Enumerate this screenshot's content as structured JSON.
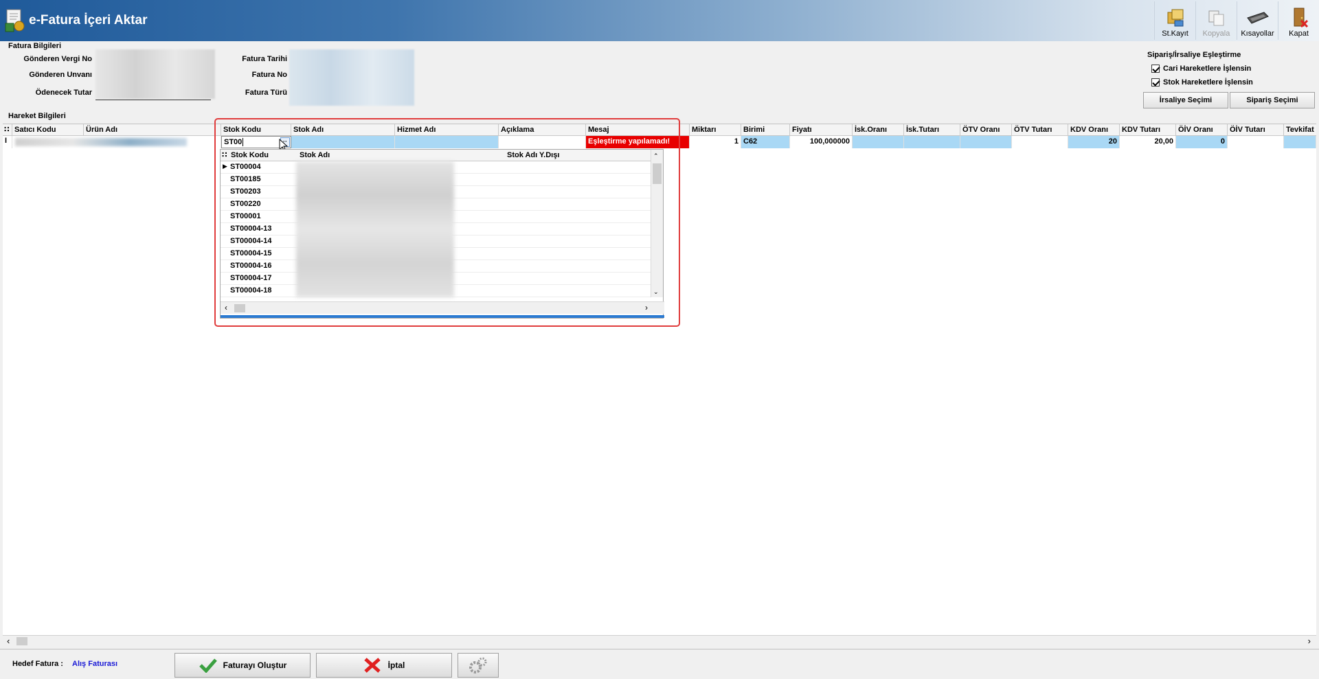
{
  "window": {
    "title": "e-Fatura İçeri Aktar"
  },
  "toolbar": {
    "items": [
      {
        "label": "St.Kayıt",
        "icon": "stock-record-icon",
        "enabled": true
      },
      {
        "label": "Kopyala",
        "icon": "copy-icon",
        "enabled": false
      },
      {
        "label": "Kısayollar",
        "icon": "keyboard-icon",
        "enabled": true
      },
      {
        "label": "Kapat",
        "icon": "exit-door-icon",
        "enabled": true
      }
    ]
  },
  "fatura_bilgileri": {
    "title": "Fatura Bilgileri",
    "labels": {
      "gonderen_vergi_no": "Gönderen Vergi No",
      "gonderen_unvani": "Gönderen Unvanı",
      "odenecek_tutar": "Ödenecek Tutar",
      "fatura_tarihi": "Fatura Tarihi",
      "fatura_no": "Fatura No",
      "fatura_turu": "Fatura Türü"
    }
  },
  "eslestirme": {
    "title": "Sipariş/İrsaliye Eşleştirme",
    "cari_label": "Cari Hareketlere İşlensin",
    "cari_checked": true,
    "stok_label": "Stok Hareketlere İşlensin",
    "stok_checked": true,
    "irsaliye_button": "İrsaliye Seçimi",
    "siparis_button": "Sipariş Seçimi"
  },
  "hareket_bilgileri": {
    "title": "Hareket Bilgileri",
    "columns": [
      "Satıcı Kodu",
      "Ürün Adı",
      "Stok Kodu",
      "Stok Adı",
      "Hizmet Adı",
      "Açıklama",
      "Mesaj",
      "Miktarı",
      "Birimi",
      "Fiyatı",
      "İsk.Oranı",
      "İsk.Tutarı",
      "ÖTV Oranı",
      "ÖTV Tutarı",
      "KDV Oranı",
      "KDV Tutarı",
      "ÖİV Oranı",
      "ÖİV Tutarı",
      "Tevkifat"
    ],
    "row": {
      "stok_kodu": "ST00",
      "mesaj": "Eşleştirme yapılamadı!",
      "miktari": "1",
      "birimi": "C62",
      "fiyati": "100,000000",
      "kdv_orani": "20",
      "kdv_tutari": "20,00",
      "oiv_orani": "0"
    }
  },
  "lookup": {
    "columns": [
      "Stok Kodu",
      "Stok Adı",
      "Stok Adı Y.Dışı"
    ],
    "codes": [
      "ST00004",
      "ST00185",
      "ST00203",
      "ST00220",
      "ST00001",
      "ST00004-13",
      "ST00004-14",
      "ST00004-15",
      "ST00004-16",
      "ST00004-17",
      "ST00004-18"
    ]
  },
  "footer": {
    "hedef_label": "Hedef Fatura :",
    "hedef_value": "Alış Faturası",
    "create_button": "Faturayı Oluştur",
    "cancel_button": "İptal"
  },
  "colors": {
    "accent": "#1f5a9a",
    "selection": "#a9d8f5",
    "error": "#e80000",
    "highlight_frame": "#e03c3c",
    "link": "#1a1ad6"
  }
}
